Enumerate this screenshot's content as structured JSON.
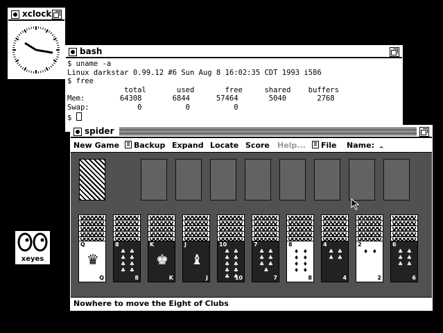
{
  "xclock": {
    "title": "xclock"
  },
  "bash": {
    "title": "bash",
    "lines": [
      "$ uname -a",
      "Linux darkstar 0.99.12 #6 Sun Aug 8 16:02:35 CDT 1993 i586",
      "$ free",
      "             total       used       free     shared    buffers",
      "Mem:        64308       6844      57464       5040       2768",
      "Swap:           0          0          0"
    ],
    "prompt": "$ "
  },
  "spider": {
    "title": "spider",
    "menu": {
      "new_game": "New Game",
      "backup": "Backup",
      "expand": "Expand",
      "locate": "Locate",
      "score": "Score",
      "help": "Help...",
      "file": "File",
      "name": "Name:"
    },
    "columns": [
      {
        "top": {
          "rank": "Q",
          "suit": "♥",
          "face": "♛",
          "light": true
        }
      },
      {
        "top": {
          "rank": "8",
          "suit": "♣",
          "light": false
        }
      },
      {
        "top": {
          "rank": "K",
          "suit": "♣",
          "face": "♚",
          "light": false
        }
      },
      {
        "top": {
          "rank": "J",
          "suit": "♠",
          "face": "♝",
          "light": false
        }
      },
      {
        "top": {
          "rank": "10",
          "suit": "♣",
          "light": false
        }
      },
      {
        "top": {
          "rank": "7",
          "suit": "♣",
          "light": false
        }
      },
      {
        "top": {
          "rank": "8",
          "suit": "♦",
          "light": true
        }
      },
      {
        "top": {
          "rank": "4",
          "suit": "♣",
          "light": false
        }
      },
      {
        "top": {
          "rank": "2",
          "suit": "♦",
          "light": true
        }
      },
      {
        "top": {
          "rank": "6",
          "suit": "♣",
          "light": false
        }
      }
    ],
    "status": "Nowhere to move the Eight of Clubs"
  },
  "xeyes": {
    "label": "xeyes"
  }
}
